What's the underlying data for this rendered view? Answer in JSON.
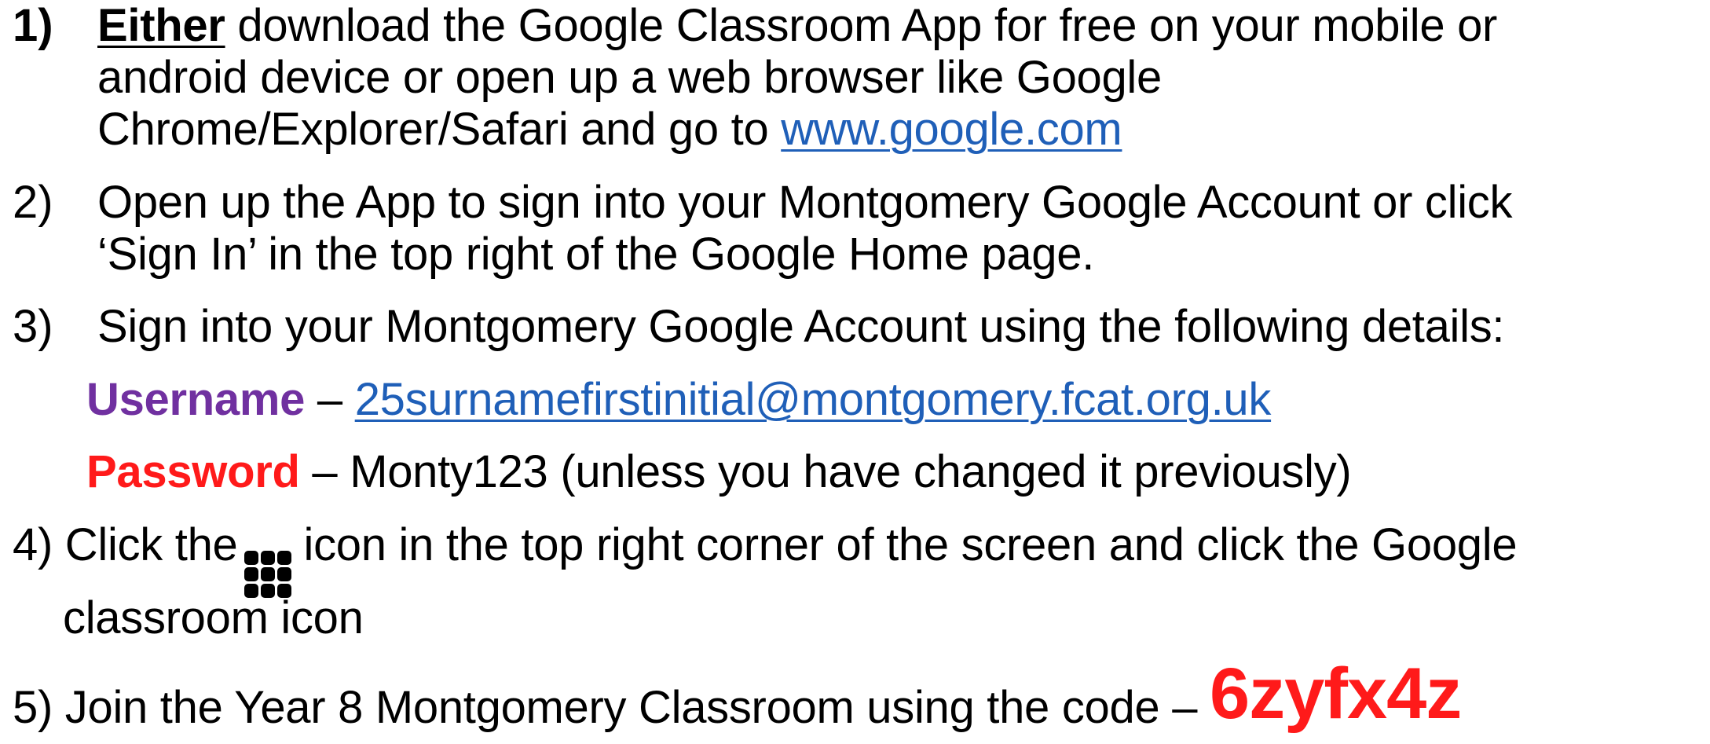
{
  "step1": {
    "number": "1)",
    "either": "Either",
    "line1_rest": " download the Google Classroom App for free on your mobile or",
    "line2": "android device or open up a web browser like Google",
    "line3_prefix": "Chrome/Explorer/Safari and go to ",
    "link": "www.google.com"
  },
  "step2": {
    "number": "2)",
    "line1": "Open up the App to sign into your Montgomery Google Account or click",
    "line2": "‘Sign In’ in the top right of the Google Home page."
  },
  "step3": {
    "number": "3)",
    "line1": "Sign into your Montgomery Google Account using the following details:",
    "username_label": "Username",
    "username_dash": " – ",
    "username_value": "25surnamefirstinitial@montgomery.fcat.org.uk",
    "password_label": "Password",
    "password_rest": " – Monty123 (unless you have changed it previously)"
  },
  "step4": {
    "prefix": "4) Click the",
    "icon": "apps-grid-icon",
    "line1_rest": "icon in the top right corner of the screen and click the Google",
    "line2": "classroom icon"
  },
  "step5": {
    "prefix": "5) Join the Year 8 Montgomery Classroom using the code – ",
    "code": "6zyfx4z"
  },
  "colors": {
    "link": "#1f5fb8",
    "username": "#7030a0",
    "password": "#ff1a1a",
    "code": "#ff1a1a"
  }
}
